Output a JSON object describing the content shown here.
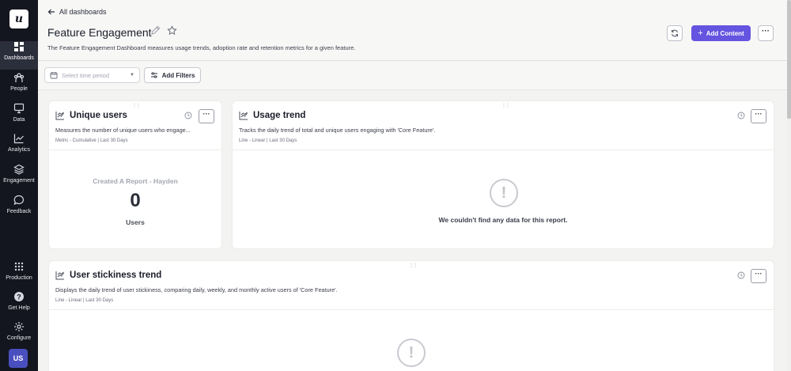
{
  "sidebar": {
    "logo": "u",
    "items": [
      {
        "label": "Dashboards",
        "icon": "dashboard-icon"
      },
      {
        "label": "People",
        "icon": "people-icon"
      },
      {
        "label": "Data",
        "icon": "data-icon"
      },
      {
        "label": "Analytics",
        "icon": "analytics-icon"
      },
      {
        "label": "Engagement",
        "icon": "engagement-icon"
      },
      {
        "label": "Feedback",
        "icon": "feedback-icon"
      },
      {
        "label": "Production",
        "icon": "grid-icon"
      },
      {
        "label": "Get Help",
        "icon": "help-icon"
      },
      {
        "label": "Configure",
        "icon": "gear-icon"
      }
    ],
    "avatar": "US"
  },
  "header": {
    "back_label": "All dashboards",
    "title": "Feature Engagement",
    "description": "The Feature Engagement Dashboard measures usage trends, adoption rate and retention metrics for a given feature.",
    "add_content_label": "Add Content",
    "more_label": "···",
    "accent": "#6454e0"
  },
  "filters": {
    "time_placeholder": "Select time period",
    "add_filters_label": "Add Filters"
  },
  "cards": {
    "unique_users": {
      "title": "Unique users",
      "description": "Measures the number of unique users who engage...",
      "meta": "Metric - Cumulative | Last 30 Days",
      "metric_label": "Created A Report - Hayden",
      "metric_value": "0",
      "metric_unit": "Users"
    },
    "usage_trend": {
      "title": "Usage trend",
      "description": "Tracks the daily trend of total and unique users engaging with 'Core Feature'.",
      "meta": "Line - Linear | Last 30 Days",
      "empty_message": "We couldn't find any data for this report."
    },
    "stickiness": {
      "title": "User stickiness trend",
      "description": "Displays the daily trend of user stickiness, comparing daily, weekly, and monthly active users of 'Core Feature'.",
      "meta": "Line - Linear | Last 30 Days"
    },
    "more_label": "···",
    "empty_icon": "!"
  }
}
